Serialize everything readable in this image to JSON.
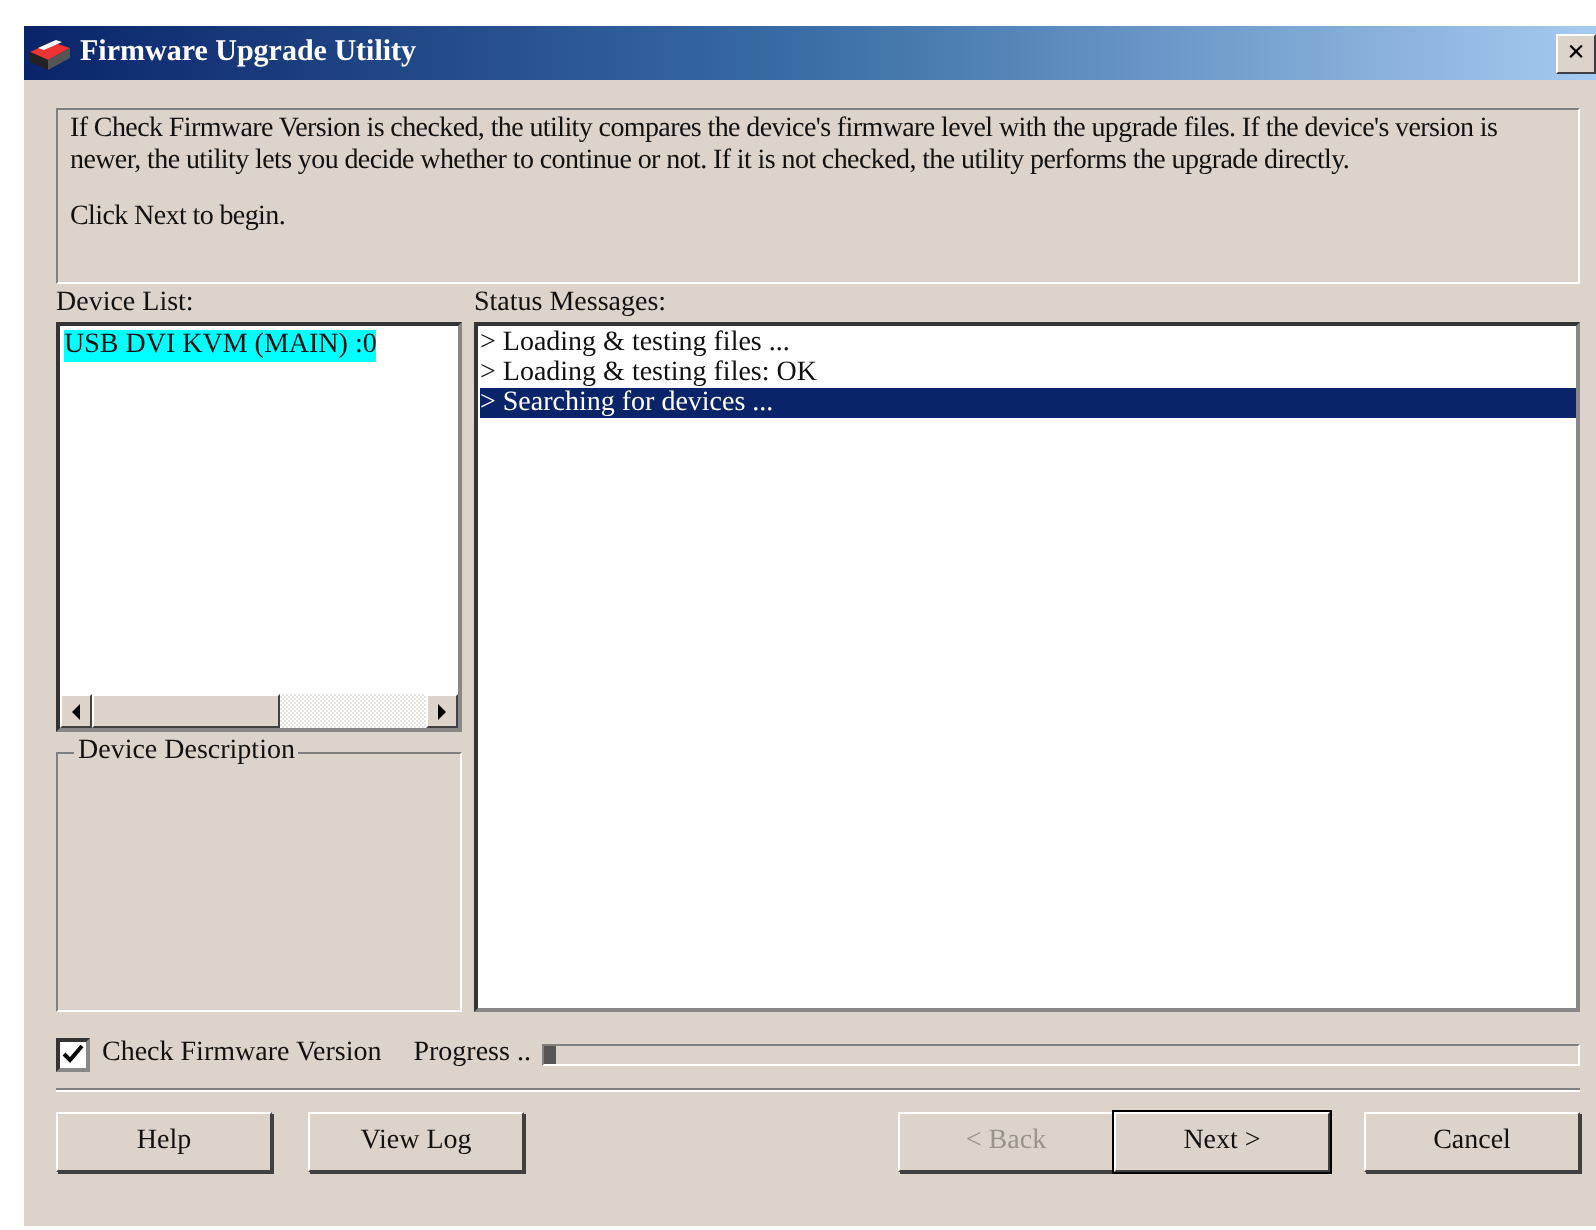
{
  "window": {
    "title": "Firmware Upgrade Utility",
    "close": "×"
  },
  "intro": {
    "text": "If Check Firmware Version is checked, the utility compares the device's firmware level with the upgrade files. If the device's version is newer, the utility lets you decide whether to continue or not. If it is not checked, the utility performs the upgrade directly.",
    "hint": "Click Next to begin."
  },
  "device_list": {
    "label": "Device List:",
    "items": [
      {
        "text": "USB DVI KVM (MAIN) :0",
        "selected": true
      }
    ]
  },
  "device_description": {
    "label": "Device Description"
  },
  "status_messages": {
    "label": "Status Messages:",
    "items": [
      {
        "text": "> Loading & testing files ...",
        "selected": false
      },
      {
        "text": "> Loading & testing files: OK",
        "selected": false
      },
      {
        "text": "> Searching for devices ...",
        "selected": true
      }
    ]
  },
  "check_firmware": {
    "label": "Check Firmware Version",
    "checked": true
  },
  "progress": {
    "label": "Progress ..",
    "level": 0.01
  },
  "buttons": [
    {
      "label": "Help",
      "kind": "left",
      "disabled": false,
      "default": false
    },
    {
      "label": "View Log",
      "kind": "left",
      "disabled": false,
      "default": false
    },
    {
      "label": "< Back",
      "kind": "right",
      "disabled": true,
      "default": false
    },
    {
      "label": "Next >",
      "kind": "right",
      "disabled": false,
      "default": true
    },
    {
      "label": "Cancel",
      "kind": "far",
      "disabled": false,
      "default": false
    }
  ]
}
